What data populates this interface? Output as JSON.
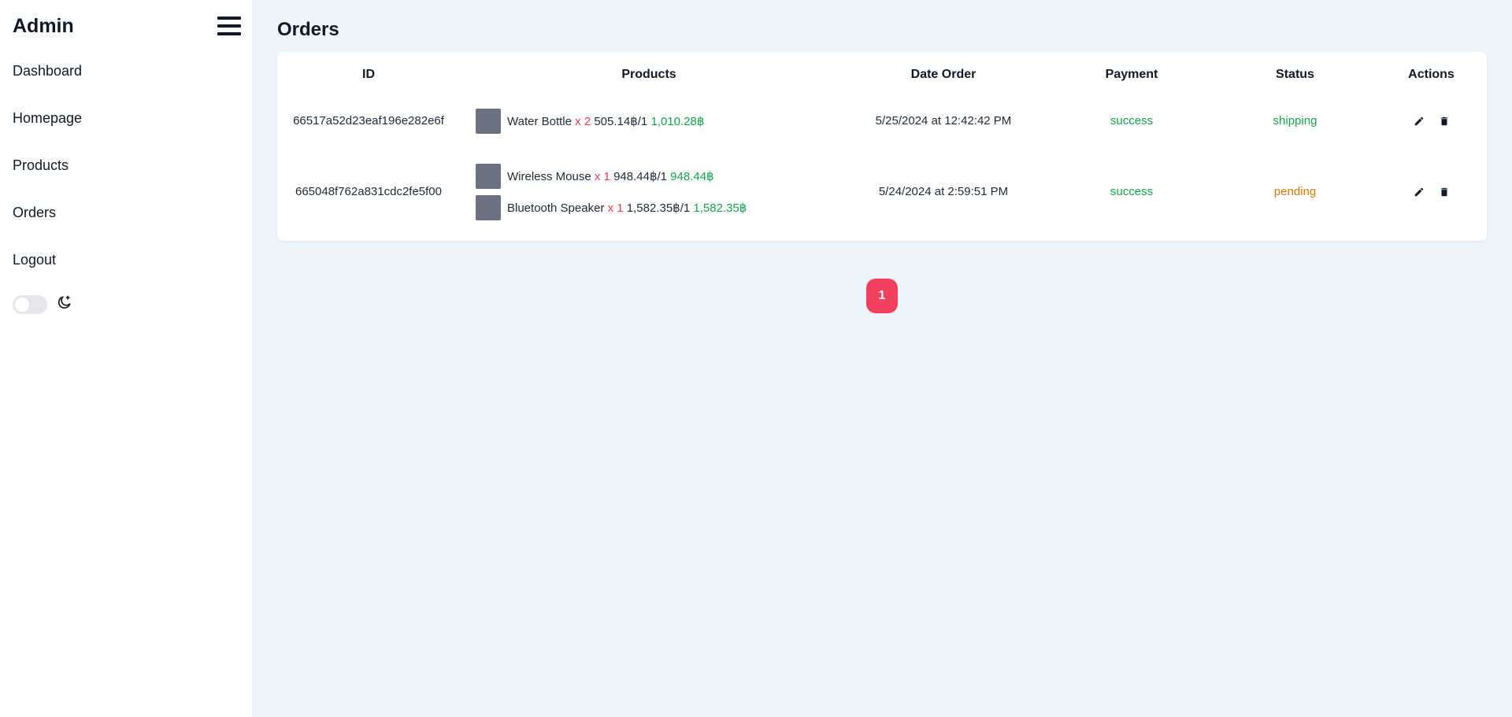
{
  "sidebar": {
    "brand": "Admin",
    "items": [
      {
        "label": "Dashboard"
      },
      {
        "label": "Homepage"
      },
      {
        "label": "Products"
      },
      {
        "label": "Orders"
      },
      {
        "label": "Logout"
      }
    ],
    "theme_toggle": {
      "state": "off",
      "icon": "moon-sparkle-icon"
    }
  },
  "main": {
    "title": "Orders",
    "table": {
      "headers": [
        "ID",
        "Products",
        "Date Order",
        "Payment",
        "Status",
        "Actions"
      ],
      "rows": [
        {
          "id": "66517a52d23eaf196e282e6f",
          "products": [
            {
              "name": "Water Bottle",
              "qty": "x 2",
              "unit": "505.14฿/1",
              "total": "1,010.28฿"
            }
          ],
          "date": "5/25/2024 at 12:42:42 PM",
          "payment": "success",
          "status": "shipping"
        },
        {
          "id": "665048f762a831cdc2fe5f00",
          "products": [
            {
              "name": "Wireless Mouse",
              "qty": "x 1",
              "unit": "948.44฿/1",
              "total": "948.44฿"
            },
            {
              "name": "Bluetooth Speaker",
              "qty": "x 1",
              "unit": "1,582.35฿/1",
              "total": "1,582.35฿"
            }
          ],
          "date": "5/24/2024 at 2:59:51 PM",
          "payment": "success",
          "status": "pending"
        }
      ]
    },
    "pagination": {
      "current": "1"
    }
  },
  "colors": {
    "accent": "#f43f5e",
    "success": "#16a34a",
    "pending": "#d97706",
    "qty": "#e53e4f",
    "background": "#edf5fd"
  }
}
